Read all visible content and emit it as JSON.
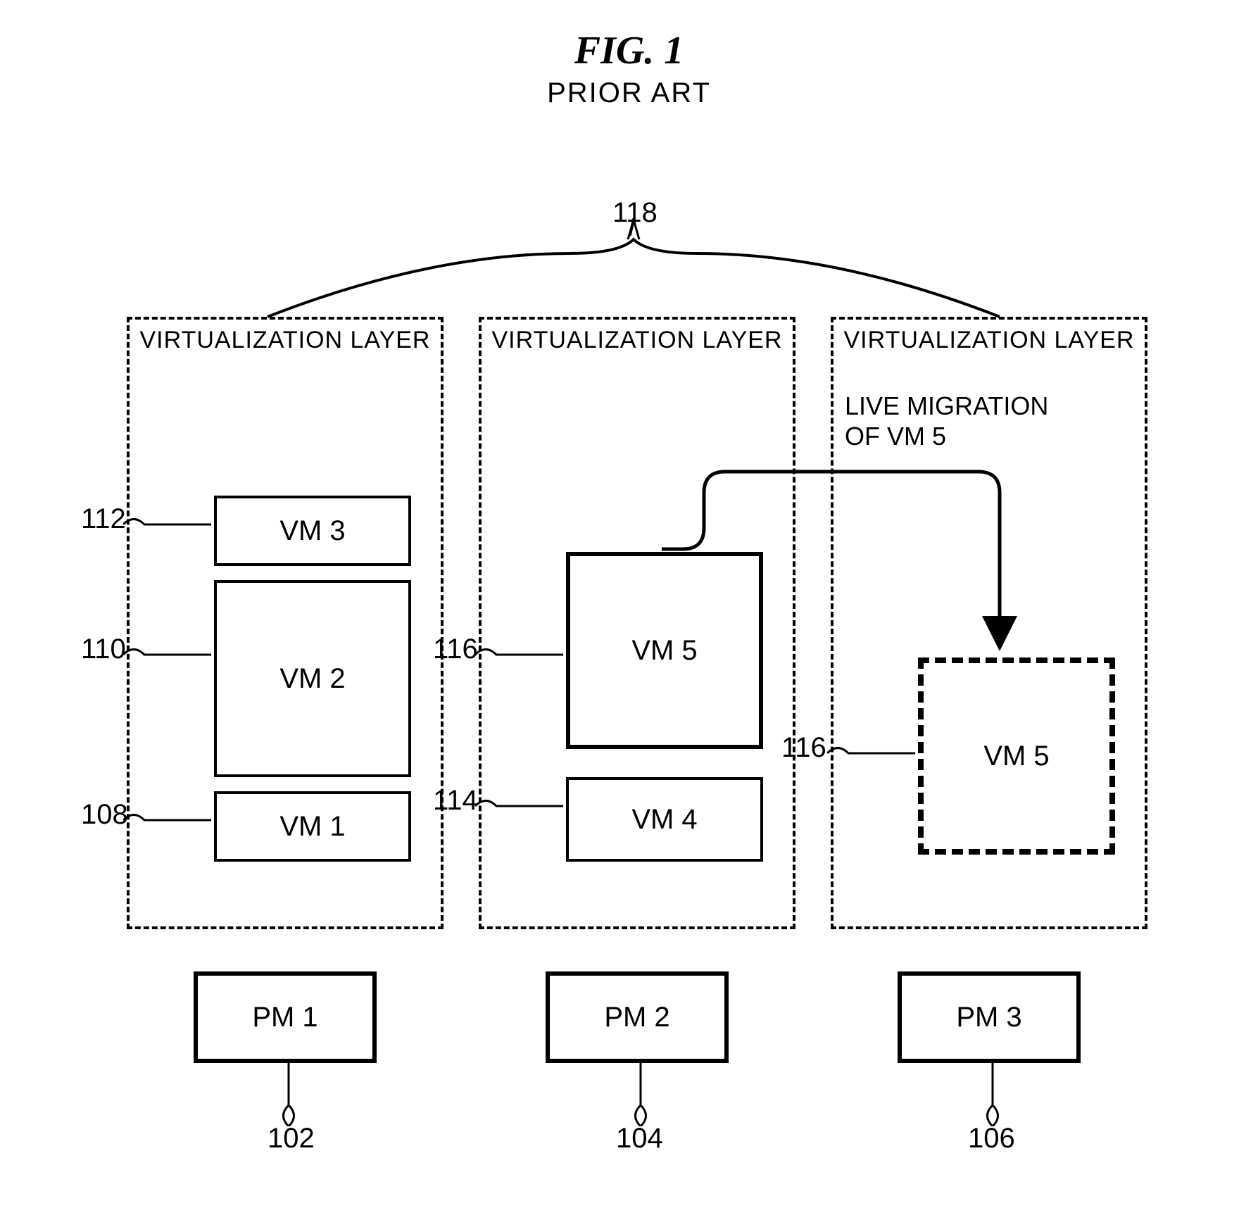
{
  "figure": {
    "title": "FIG. 1",
    "subtitle": "PRIOR ART"
  },
  "ref_numbers": {
    "brace": "118",
    "vm3": "112",
    "vm2": "110",
    "vm1": "108",
    "vm5_src": "116",
    "vm4": "114",
    "vm5_dest": "116",
    "pm1": "102",
    "pm2": "104",
    "pm3": "106"
  },
  "layers": {
    "layer1_title": "VIRTUALIZATION LAYER",
    "layer2_title": "VIRTUALIZATION LAYER",
    "layer3_title": "VIRTUALIZATION LAYER"
  },
  "vms": {
    "vm1": "VM 1",
    "vm2": "VM 2",
    "vm3": "VM 3",
    "vm4": "VM 4",
    "vm5_src": "VM 5",
    "vm5_dest": "VM 5"
  },
  "pms": {
    "pm1": "PM 1",
    "pm2": "PM 2",
    "pm3": "PM 3"
  },
  "migration": {
    "line1": "LIVE MIGRATION",
    "line2": "OF VM 5"
  }
}
